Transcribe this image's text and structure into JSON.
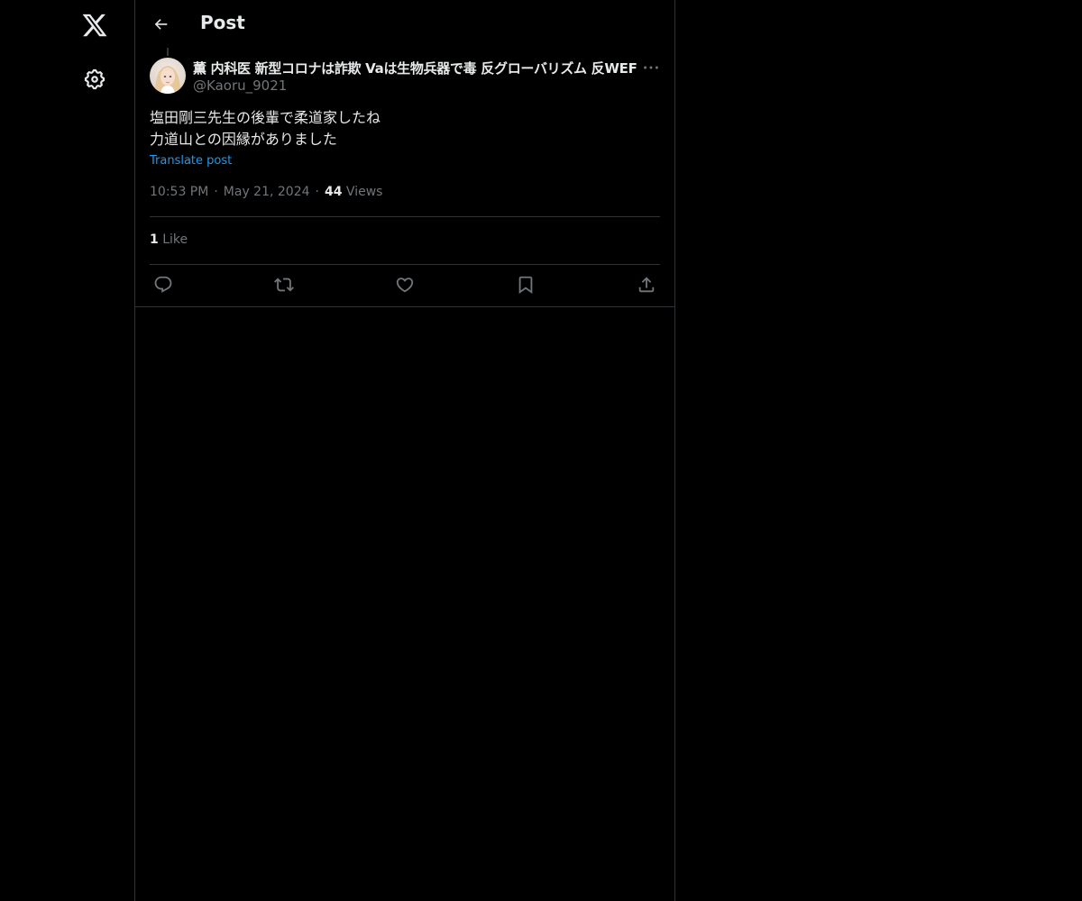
{
  "nav": {
    "logo_icon": "x-logo-icon",
    "settings_icon": "gear-icon"
  },
  "header": {
    "back_icon": "arrow-left-icon",
    "title": "Post"
  },
  "post": {
    "author_name": "薫 内科医 新型コロナは詐欺 Vaは生物兵器で毒 反グローバリズム 反WEF",
    "author_handle": "@Kaoru_9021",
    "more_icon": "more-horizontal-icon",
    "text_lines": [
      "塩田剛三先生の後輩で柔道家したね",
      "力道山との因縁がありました"
    ],
    "translate_label": "Translate post",
    "time": "10:53 PM",
    "date": "May 21, 2024",
    "views_count": "44",
    "views_label": "Views",
    "likes_count": "1",
    "likes_label": "Like"
  },
  "actions": [
    {
      "name": "reply",
      "icon": "reply-icon"
    },
    {
      "name": "repost",
      "icon": "repost-icon"
    },
    {
      "name": "like",
      "icon": "heart-icon"
    },
    {
      "name": "bookmark",
      "icon": "bookmark-icon"
    },
    {
      "name": "share",
      "icon": "share-icon"
    }
  ],
  "colors": {
    "background": "#000000",
    "border": "#2f3336",
    "text": "#e7e9ea",
    "secondary": "#71767b",
    "accent": "#1d9bf0"
  }
}
